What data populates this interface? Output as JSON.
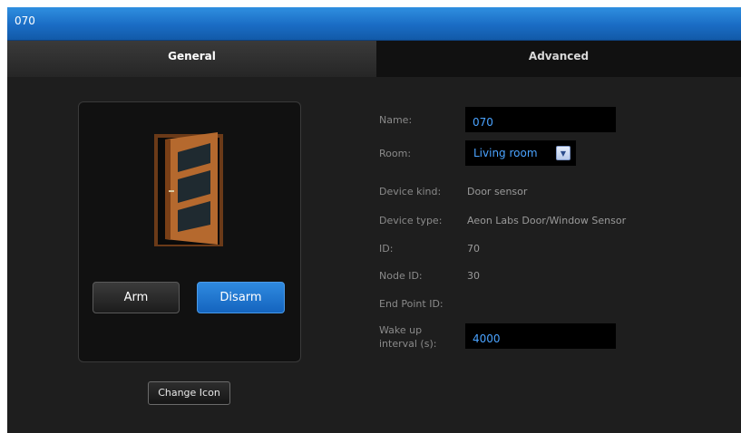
{
  "window": {
    "title": "070"
  },
  "tabs": [
    {
      "label": "General",
      "active": true
    },
    {
      "label": "Advanced",
      "active": false
    }
  ],
  "device_icon": {
    "name": "door-icon"
  },
  "buttons": {
    "arm": "Arm",
    "disarm": "Disarm",
    "change_icon": "Change Icon"
  },
  "fields": {
    "name": {
      "label": "Name:",
      "value": "070"
    },
    "room": {
      "label": "Room:",
      "value": "Living room"
    },
    "device_kind": {
      "label": "Device kind:",
      "value": "Door sensor"
    },
    "device_type": {
      "label": "Device type:",
      "value": "Aeon Labs Door/Window Sensor"
    },
    "id": {
      "label": "ID:",
      "value": "70"
    },
    "node_id": {
      "label": "Node ID:",
      "value": "30"
    },
    "end_point_id": {
      "label": "End Point ID:",
      "value": ""
    },
    "wake_up": {
      "label_line1": "Wake up",
      "label_line2": "interval (s):",
      "value": "4000"
    }
  },
  "colors": {
    "accent": "#1a6cc4",
    "input_text": "#4aa3ff",
    "background": "#1e1e1e"
  }
}
